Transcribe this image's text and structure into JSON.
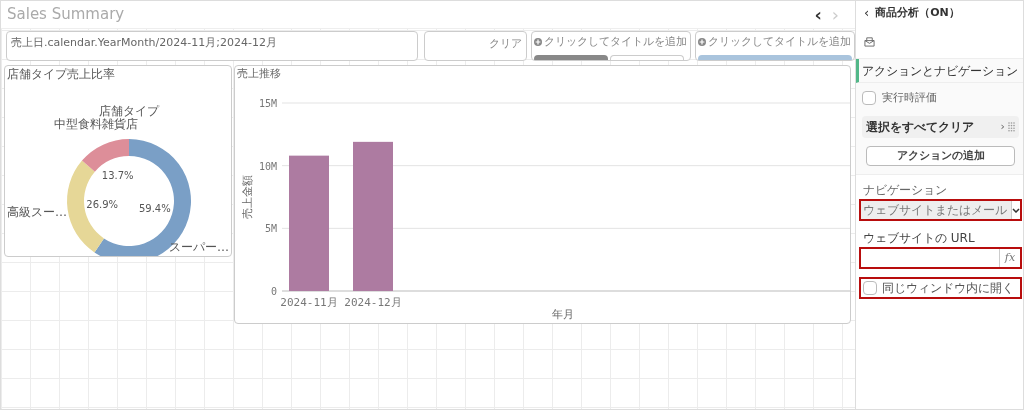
{
  "sheet": {
    "title": "Sales Summary",
    "nav": [
      {
        "glyph": "‹",
        "disabled": false
      },
      {
        "glyph": "›",
        "disabled": true
      }
    ]
  },
  "filter_bar": {
    "text": "売上日.calendar.YearMonth/2024-11月;2024-12月"
  },
  "clear_box": {
    "label": "クリア"
  },
  "title_boxes": [
    {
      "text": "クリックしてタイトルを追加",
      "kind": "two-buttons"
    },
    {
      "text": "クリックしてタイトルを追加",
      "kind": "one-button"
    }
  ],
  "donut_panel": {
    "title": "店舗タイプ売上比率",
    "chart_data": {
      "type": "donut",
      "title": "店舗タイプ",
      "categories": [
        "スーパー…",
        "高級スー…",
        "中型食料雑貨店"
      ],
      "values": [
        59.4,
        26.9,
        13.7
      ],
      "value_labels": [
        "59.4%",
        "26.9%",
        "13.7%"
      ]
    }
  },
  "bar_panel": {
    "title": "売上推移",
    "x_axis_title": "年月",
    "chart_data": {
      "type": "bar",
      "ylabel": "売上金額",
      "categories": [
        "2024-11月",
        "2024-12月"
      ],
      "series": [
        {
          "color": "#ad7ba1",
          "values": [
            10800000,
            11900000
          ]
        }
      ],
      "ylim": [
        0,
        15000000
      ],
      "yticks": [
        {
          "value": 0,
          "label": "0"
        },
        {
          "value": 5000000,
          "label": "5M"
        },
        {
          "value": 10000000,
          "label": "10M"
        },
        {
          "value": 15000000,
          "label": "15M"
        }
      ]
    }
  },
  "properties": {
    "back": "‹",
    "title": "商品分析（ON）",
    "section": "アクションとナビゲーション",
    "runtime_eval": {
      "label": "実行時評価",
      "checked": false
    },
    "actions": [
      {
        "label": "選択をすべてクリア",
        "glyph": "›"
      }
    ],
    "add_action": "アクションの追加",
    "navigation": {
      "label": "ナビゲーション",
      "placeholder": "ウェブサイトまたはメール",
      "disabled": true,
      "highlighted": true
    },
    "url": {
      "label": "ウェブサイトの URL",
      "fx": "fx",
      "highlighted": true
    },
    "same_window": {
      "label": "同じウィンドウ内に開く",
      "checked": false,
      "highlighted": true
    }
  }
}
